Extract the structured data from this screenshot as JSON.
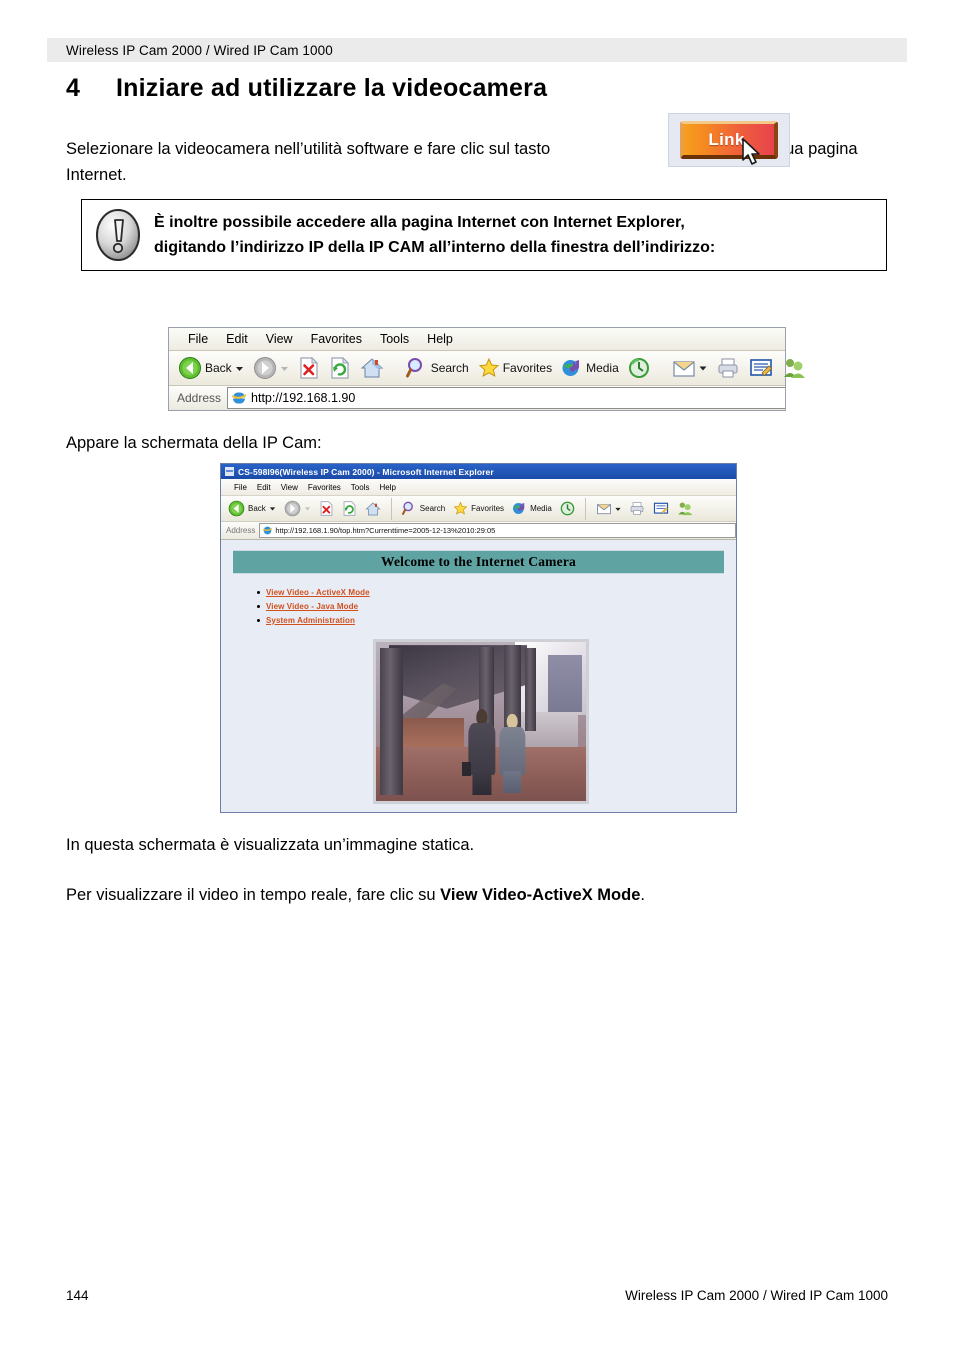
{
  "header": {
    "running_title": "Wireless IP Cam 2000 / Wired IP Cam 1000"
  },
  "chapter": {
    "number": "4",
    "title": "Iniziare ad utilizzare la videocamera"
  },
  "body": {
    "intro_before": "Selezionare la videocamera nell’utilità software e fare clic sul tasto",
    "intro_after": "per aprire la sua pagina Internet.",
    "appare": "Appare la schermata della IP Cam:",
    "static_image": "In questa schermata è visualizzata un’immagine statica.",
    "realtime_before": "Per visualizzare il video in tempo reale, fare clic su ",
    "realtime_bold": "View Video-ActiveX Mode",
    "realtime_after": "."
  },
  "link_button": {
    "label": "Link"
  },
  "note": {
    "line1": "È inoltre possibile accedere alla pagina Internet con Internet Explorer,",
    "line2": "digitando l’indirizzo IP della IP CAM all’interno della finestra dell’indirizzo:"
  },
  "ie_toolbar_figure": {
    "menu": [
      "File",
      "Edit",
      "View",
      "Favorites",
      "Tools",
      "Help"
    ],
    "buttons": [
      {
        "icon": "back-arrow-icon",
        "label": "Back"
      },
      {
        "icon": "chevron-down-icon",
        "label": ""
      },
      {
        "icon": "forward-arrow-icon",
        "label": ""
      },
      {
        "icon": "chevron-down-icon",
        "label": ""
      },
      {
        "icon": "stop-icon",
        "label": ""
      },
      {
        "icon": "refresh-icon",
        "label": ""
      },
      {
        "icon": "home-icon",
        "label": ""
      },
      {
        "icon": "search-icon",
        "label": "Search"
      },
      {
        "icon": "favorites-star-icon",
        "label": "Favorites"
      },
      {
        "icon": "media-icon",
        "label": "Media"
      },
      {
        "icon": "history-icon",
        "label": ""
      },
      {
        "icon": "mail-icon",
        "label": ""
      },
      {
        "icon": "print-icon",
        "label": ""
      },
      {
        "icon": "edit-icon",
        "label": ""
      },
      {
        "icon": "messenger-icon",
        "label": ""
      }
    ],
    "address_label": "Address",
    "address_value": "http://192.168.1.90"
  },
  "camera_window": {
    "title": "CS-598I96(Wireless IP Cam 2000) - Microsoft Internet Explorer",
    "menu": [
      "File",
      "Edit",
      "View",
      "Favorites",
      "Tools",
      "Help"
    ],
    "buttons": [
      {
        "icon": "back-arrow-icon",
        "label": "Back"
      },
      {
        "icon": "forward-arrow-icon",
        "label": ""
      },
      {
        "icon": "stop-icon",
        "label": ""
      },
      {
        "icon": "refresh-icon",
        "label": ""
      },
      {
        "icon": "home-icon",
        "label": ""
      },
      {
        "icon": "search-icon",
        "label": "Search"
      },
      {
        "icon": "favorites-star-icon",
        "label": "Favorites"
      },
      {
        "icon": "media-icon",
        "label": "Media"
      },
      {
        "icon": "history-icon",
        "label": ""
      },
      {
        "icon": "mail-icon",
        "label": ""
      },
      {
        "icon": "print-icon",
        "label": ""
      },
      {
        "icon": "edit-icon",
        "label": ""
      },
      {
        "icon": "messenger-icon",
        "label": ""
      }
    ],
    "address_label": "Address",
    "address_value": "http://192.168.1.90/top.htm?Currenttime=2005-12-13%2010:29:05",
    "page": {
      "banner": "Welcome to the Internet Camera",
      "links": [
        "View Video - ActiveX Mode",
        "View Video - Java Mode",
        "System Administration"
      ],
      "photo_alt": "static camera snapshot of two people walking under a building canopy"
    }
  },
  "footer": {
    "page_number": "144",
    "title": "Wireless IP Cam 2000 / Wired IP Cam 1000"
  },
  "colors": {
    "header_band": "#ebebeb",
    "banner_teal": "#5fa3a3",
    "link_orange": "#d2501e",
    "titlebar_blue": "#2a63c8",
    "page_bg": "#e7ecf5"
  }
}
